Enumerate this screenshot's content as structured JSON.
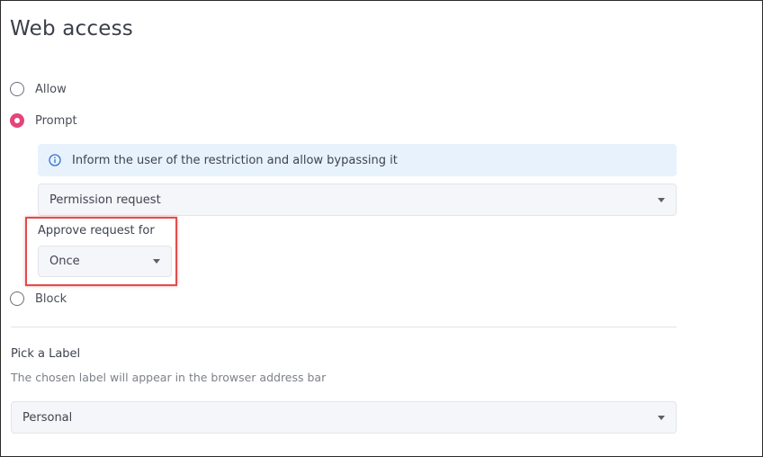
{
  "page": {
    "title": "Web access"
  },
  "access_options": {
    "allow": {
      "label": "Allow",
      "checked": false
    },
    "prompt": {
      "label": "Prompt",
      "checked": true
    },
    "block": {
      "label": "Block",
      "checked": false
    }
  },
  "prompt_settings": {
    "info_text": "Inform the user of the restriction and allow bypassing it",
    "prompt_type": {
      "selected": "Permission request"
    },
    "approve_for": {
      "label": "Approve request for",
      "selected": "Once"
    }
  },
  "label_section": {
    "title": "Pick a Label",
    "description": "The chosen label will appear in the browser address bar",
    "selected": "Personal"
  },
  "colors": {
    "accent": "#e5447a",
    "info_background": "#e8f2fd",
    "highlight": "#e14c4c"
  },
  "icons": {
    "info": "info-circle-icon",
    "dropdown": "caret-down-icon"
  }
}
